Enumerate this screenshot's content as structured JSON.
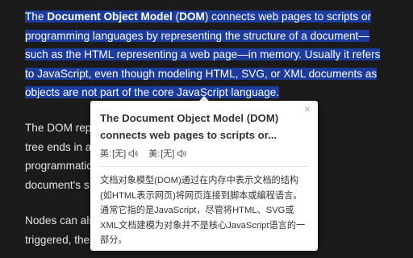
{
  "article": {
    "para1": {
      "pre": "The ",
      "bold": "Document Object Model",
      "mid": " (",
      "bold2": "DOM",
      "post": ") connects web pages to scripts or\nprogramming languages by representing the structure of a document—\nsuch as the HTML representing a web page—in memory. Usually it refers\nto JavaScript, even though modeling HTML, SVG, or XML documents as\nobjects are not part of the core JavaScript language."
    },
    "para2": "The DOM rep                                                        ranch of the\ntree ends in a                                                        methods allow\nprogrammatic                                                          e the\ndocument's s",
    "para3": "Nodes can als                                                         e an event is\ntriggered, the"
  },
  "popup": {
    "close_label": "×",
    "title": "The Document Object Model (DOM)\nconnects web pages to scripts or...",
    "uk_label": "英:",
    "uk_value": "[无]",
    "us_label": "美:",
    "us_value": "[无]",
    "translation": "文档对象模型(DOM)通过在内存中表示文档的结构\n(如HTML表示网页)将网页连接到脚本或编程语言。\n通常它指的是JavaScript，尽管将HTML、SVG或\nXML文档建模为对象并不是核心JavaScript语言的一\n部分。",
    "speaker_icon": "speaker-icon"
  },
  "colors": {
    "background": "#1b1b1b",
    "selection": "#1b3c9d",
    "text": "#e6e6e6"
  }
}
